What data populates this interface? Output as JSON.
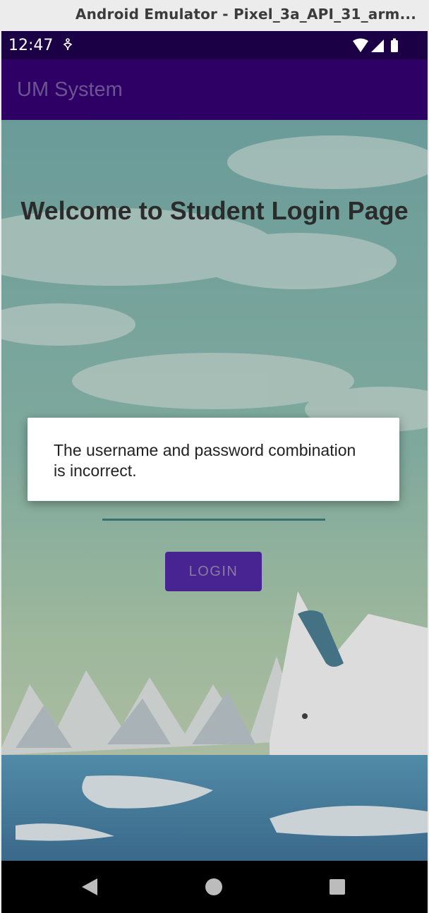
{
  "window": {
    "title": "Android Emulator - Pixel_3a_API_31_arm..."
  },
  "status_bar": {
    "time": "12:47",
    "icons": [
      "accessibility-icon",
      "wifi-icon",
      "signal-icon",
      "battery-icon"
    ]
  },
  "app_bar": {
    "title": "UM System"
  },
  "main": {
    "heading": "Welcome to Student Login Page",
    "password_masked": "•••••",
    "login_label": "LOGIN"
  },
  "dialog": {
    "message": "The username and password combination is incorrect."
  },
  "nav_bar": {
    "icons": [
      "back-icon",
      "home-icon",
      "recents-icon"
    ]
  },
  "colors": {
    "status_bar": "#1c0046",
    "app_bar": "#2e0066",
    "button": "#33009a",
    "input_underline": "#1f6b66"
  }
}
